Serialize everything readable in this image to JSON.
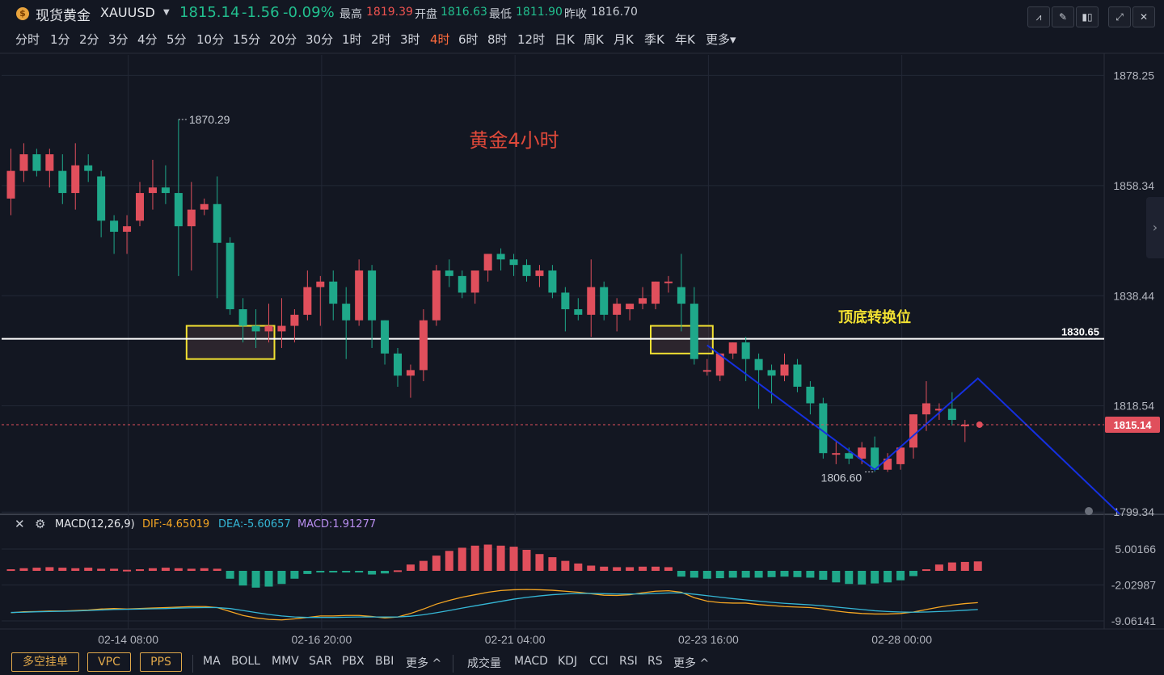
{
  "header": {
    "symbol_name": "现货黄金",
    "symbol_code": "XAUUSD",
    "price": "1815.14",
    "change": "-1.56",
    "change_pct": "-0.09%",
    "high_label": "最高",
    "high": "1819.39",
    "open_label": "开盘",
    "open": "1816.63",
    "low_label": "最低",
    "low": "1811.90",
    "prev_close_label": "昨收",
    "prev_close": "1816.70"
  },
  "intervals": [
    "分时",
    "1分",
    "2分",
    "3分",
    "4分",
    "5分",
    "10分",
    "15分",
    "20分",
    "30分",
    "1时",
    "2时",
    "3时",
    "4时",
    "6时",
    "8时",
    "12时",
    "日K",
    "周K",
    "月K",
    "季K",
    "年K",
    "更多▾"
  ],
  "active_interval": "4时",
  "bottom_buttons": [
    "多空挂单",
    "VPC",
    "PPS"
  ],
  "main_indicators": [
    "MA",
    "BOLL",
    "MMV",
    "SAR",
    "PBX",
    "BBI",
    "更多 ^"
  ],
  "sub_indicators": [
    "成交量",
    "MACD",
    "KDJ",
    "CCI",
    "RSI",
    "RS",
    "更多 ^"
  ],
  "chart_data": {
    "type": "candlestick",
    "title": "黄金4小时",
    "annotation": "顶底转换位",
    "price_axis_ticks": [
      "1878.25",
      "1858.34",
      "1838.44",
      "1818.54",
      "1799.34"
    ],
    "time_axis_ticks": [
      "02-14 08:00",
      "02-16 20:00",
      "02-21 04:00",
      "02-23 16:00",
      "02-28 00:00"
    ],
    "ylim": [
      1798.5,
      1880.5
    ],
    "horizontal_line": {
      "value": 1830.65,
      "label": "1830.65"
    },
    "current_price": {
      "value": 1815.14,
      "label": "1815.14"
    },
    "max_marker": {
      "value": 1870.29,
      "label": "1870.29"
    },
    "min_marker": {
      "value": 1806.6,
      "label": "1806.60"
    },
    "candles": [
      {
        "o": 1856.0,
        "h": 1865.0,
        "l": 1853.0,
        "c": 1861.0
      },
      {
        "o": 1861.0,
        "h": 1866.0,
        "l": 1859.0,
        "c": 1864.0
      },
      {
        "o": 1864.0,
        "h": 1865.0,
        "l": 1860.0,
        "c": 1861.0
      },
      {
        "o": 1861.0,
        "h": 1865.0,
        "l": 1858.0,
        "c": 1864.0
      },
      {
        "o": 1861.0,
        "h": 1864.0,
        "l": 1855.0,
        "c": 1857.0
      },
      {
        "o": 1857.0,
        "h": 1866.0,
        "l": 1854.0,
        "c": 1862.0
      },
      {
        "o": 1862.0,
        "h": 1864.0,
        "l": 1859.0,
        "c": 1861.0
      },
      {
        "o": 1860.0,
        "h": 1861.0,
        "l": 1849.0,
        "c": 1852.0
      },
      {
        "o": 1852.0,
        "h": 1853.0,
        "l": 1846.0,
        "c": 1850.0
      },
      {
        "o": 1850.0,
        "h": 1853.0,
        "l": 1846.0,
        "c": 1851.0
      },
      {
        "o": 1852.0,
        "h": 1859.0,
        "l": 1851.0,
        "c": 1857.0
      },
      {
        "o": 1857.0,
        "h": 1863.0,
        "l": 1854.0,
        "c": 1858.0
      },
      {
        "o": 1858.0,
        "h": 1862.0,
        "l": 1855.0,
        "c": 1857.0
      },
      {
        "o": 1857.0,
        "h": 1870.3,
        "l": 1842.0,
        "c": 1851.0
      },
      {
        "o": 1851.0,
        "h": 1859.0,
        "l": 1843.0,
        "c": 1854.0
      },
      {
        "o": 1854.0,
        "h": 1856.0,
        "l": 1853.0,
        "c": 1855.0
      },
      {
        "o": 1855.0,
        "h": 1860.0,
        "l": 1838.0,
        "c": 1848.0
      },
      {
        "o": 1848.0,
        "h": 1849.0,
        "l": 1835.0,
        "c": 1836.0
      },
      {
        "o": 1836.0,
        "h": 1838.0,
        "l": 1830.0,
        "c": 1833.0
      },
      {
        "o": 1833.0,
        "h": 1836.0,
        "l": 1829.0,
        "c": 1832.0
      },
      {
        "o": 1832.0,
        "h": 1837.0,
        "l": 1830.0,
        "c": 1833.0
      },
      {
        "o": 1832.0,
        "h": 1838.0,
        "l": 1829.0,
        "c": 1833.0
      },
      {
        "o": 1833.0,
        "h": 1836.0,
        "l": 1830.0,
        "c": 1835.0
      },
      {
        "o": 1835.0,
        "h": 1843.0,
        "l": 1834.0,
        "c": 1840.0
      },
      {
        "o": 1840.0,
        "h": 1842.0,
        "l": 1833.0,
        "c": 1841.0
      },
      {
        "o": 1841.0,
        "h": 1843.0,
        "l": 1834.0,
        "c": 1837.0
      },
      {
        "o": 1837.0,
        "h": 1840.0,
        "l": 1827.0,
        "c": 1834.0
      },
      {
        "o": 1834.0,
        "h": 1845.0,
        "l": 1833.0,
        "c": 1843.0
      },
      {
        "o": 1843.0,
        "h": 1844.0,
        "l": 1829.0,
        "c": 1834.0
      },
      {
        "o": 1834.0,
        "h": 1834.0,
        "l": 1826.0,
        "c": 1828.0
      },
      {
        "o": 1828.0,
        "h": 1829.0,
        "l": 1822.0,
        "c": 1824.0
      },
      {
        "o": 1824.0,
        "h": 1826.0,
        "l": 1820.0,
        "c": 1825.0
      },
      {
        "o": 1825.0,
        "h": 1836.0,
        "l": 1823.0,
        "c": 1834.0
      },
      {
        "o": 1834.0,
        "h": 1844.0,
        "l": 1833.0,
        "c": 1843.0
      },
      {
        "o": 1843.0,
        "h": 1845.0,
        "l": 1840.0,
        "c": 1842.0
      },
      {
        "o": 1842.0,
        "h": 1843.0,
        "l": 1838.0,
        "c": 1839.0
      },
      {
        "o": 1839.0,
        "h": 1843.0,
        "l": 1837.0,
        "c": 1843.0
      },
      {
        "o": 1843.0,
        "h": 1846.0,
        "l": 1841.0,
        "c": 1846.0
      },
      {
        "o": 1846.0,
        "h": 1847.0,
        "l": 1843.0,
        "c": 1845.0
      },
      {
        "o": 1845.0,
        "h": 1846.0,
        "l": 1842.0,
        "c": 1844.0
      },
      {
        "o": 1844.0,
        "h": 1845.0,
        "l": 1841.0,
        "c": 1842.0
      },
      {
        "o": 1842.0,
        "h": 1844.0,
        "l": 1840.0,
        "c": 1843.0
      },
      {
        "o": 1843.0,
        "h": 1844.0,
        "l": 1838.0,
        "c": 1839.0
      },
      {
        "o": 1839.0,
        "h": 1840.0,
        "l": 1832.0,
        "c": 1836.0
      },
      {
        "o": 1836.0,
        "h": 1838.0,
        "l": 1834.0,
        "c": 1835.0
      },
      {
        "o": 1835.0,
        "h": 1845.0,
        "l": 1831.0,
        "c": 1840.0
      },
      {
        "o": 1840.0,
        "h": 1841.0,
        "l": 1834.0,
        "c": 1835.0
      },
      {
        "o": 1835.0,
        "h": 1838.0,
        "l": 1832.0,
        "c": 1837.0
      },
      {
        "o": 1836.0,
        "h": 1837.0,
        "l": 1834.0,
        "c": 1837.0
      },
      {
        "o": 1837.0,
        "h": 1840.0,
        "l": 1836.0,
        "c": 1838.0
      },
      {
        "o": 1837.0,
        "h": 1841.0,
        "l": 1836.0,
        "c": 1841.0
      },
      {
        "o": 1841.0,
        "h": 1842.0,
        "l": 1839.0,
        "c": 1841.0
      },
      {
        "o": 1840.0,
        "h": 1846.0,
        "l": 1832.0,
        "c": 1837.0
      },
      {
        "o": 1837.0,
        "h": 1840.0,
        "l": 1826.0,
        "c": 1827.0
      },
      {
        "o": 1825.0,
        "h": 1827.0,
        "l": 1824.0,
        "c": 1825.0
      },
      {
        "o": 1824.0,
        "h": 1828.0,
        "l": 1823.0,
        "c": 1828.0
      },
      {
        "o": 1828.0,
        "h": 1830.0,
        "l": 1827.0,
        "c": 1830.0
      },
      {
        "o": 1830.0,
        "h": 1831.0,
        "l": 1823.0,
        "c": 1827.0
      },
      {
        "o": 1827.0,
        "h": 1828.0,
        "l": 1818.0,
        "c": 1825.0
      },
      {
        "o": 1825.0,
        "h": 1826.0,
        "l": 1819.0,
        "c": 1824.0
      },
      {
        "o": 1824.0,
        "h": 1828.0,
        "l": 1823.0,
        "c": 1826.0
      },
      {
        "o": 1826.0,
        "h": 1827.0,
        "l": 1821.0,
        "c": 1822.0
      },
      {
        "o": 1822.0,
        "h": 1823.0,
        "l": 1817.0,
        "c": 1819.0
      },
      {
        "o": 1819.0,
        "h": 1820.0,
        "l": 1809.0,
        "c": 1810.0
      },
      {
        "o": 1810.0,
        "h": 1812.0,
        "l": 1808.0,
        "c": 1810.0
      },
      {
        "o": 1810.0,
        "h": 1811.0,
        "l": 1808.0,
        "c": 1809.0
      },
      {
        "o": 1809.0,
        "h": 1812.0,
        "l": 1808.0,
        "c": 1811.0
      },
      {
        "o": 1811.0,
        "h": 1813.0,
        "l": 1806.6,
        "c": 1807.0
      },
      {
        "o": 1807.0,
        "h": 1810.0,
        "l": 1806.6,
        "c": 1809.0
      },
      {
        "o": 1808.0,
        "h": 1811.0,
        "l": 1807.0,
        "c": 1811.0
      },
      {
        "o": 1811.0,
        "h": 1817.0,
        "l": 1809.0,
        "c": 1817.0
      },
      {
        "o": 1817.0,
        "h": 1823.0,
        "l": 1814.0,
        "c": 1819.0
      },
      {
        "o": 1818.0,
        "h": 1819.0,
        "l": 1816.0,
        "c": 1818.0
      },
      {
        "o": 1818.0,
        "h": 1821.0,
        "l": 1815.0,
        "c": 1816.0
      },
      {
        "o": 1815.0,
        "h": 1816.0,
        "l": 1812.0,
        "c": 1815.14
      }
    ],
    "zones": [
      {
        "from_index": 14,
        "to_index": 20,
        "low": 1827.0,
        "high": 1833.0
      },
      {
        "from_index": 50,
        "to_index": 54,
        "low": 1828.0,
        "high": 1833.0
      }
    ],
    "path_line": [
      {
        "index": 54,
        "value": 1829.5
      },
      {
        "index": 67,
        "value": 1807.0
      },
      {
        "index": 75,
        "value": 1823.5
      },
      {
        "index": 86,
        "value": 1799.0
      }
    ],
    "macd": {
      "label": "MACD(12,26,9)",
      "dif_label": "DIF:-4.65019",
      "dea_label": "DEA:-5.60657",
      "macd_label": "MACD:1.91277",
      "axis_ticks": [
        "5.00166",
        "-2.02987",
        "-9.06141"
      ],
      "ylim": [
        -10.5,
        9
      ],
      "histogram": [
        0.3,
        0.5,
        0.6,
        0.7,
        0.6,
        0.5,
        0.6,
        0.4,
        0.4,
        0.2,
        0.3,
        0.5,
        0.6,
        0.5,
        0.4,
        0.5,
        0.4,
        -1.5,
        -2.8,
        -3.2,
        -3.0,
        -2.5,
        -1.5,
        -0.6,
        -0.3,
        -0.2,
        -0.3,
        -0.3,
        -0.7,
        -0.5,
        0.1,
        1.2,
        1.9,
        2.9,
        3.8,
        4.4,
        4.8,
        5.0,
        4.8,
        4.6,
        4.0,
        3.2,
        2.6,
        1.9,
        1.4,
        1.0,
        0.8,
        0.7,
        0.7,
        0.8,
        0.8,
        0.7,
        -1.1,
        -1.3,
        -1.5,
        -1.4,
        -1.3,
        -1.3,
        -1.3,
        -1.2,
        -1.1,
        -1.2,
        -1.3,
        -1.7,
        -2.2,
        -2.5,
        -2.6,
        -2.4,
        -2.2,
        -1.8,
        -1.0,
        0.3,
        1.2,
        1.6,
        1.7,
        1.8
      ],
      "dif": [
        -6.5,
        -6.1,
        -6.0,
        -5.8,
        -5.8,
        -5.6,
        -5.4,
        -5.0,
        -4.8,
        -5.0,
        -4.8,
        -4.6,
        -4.4,
        -4.2,
        -4.0,
        -4.0,
        -4.4,
        -6.0,
        -7.6,
        -8.6,
        -9.2,
        -9.4,
        -9.0,
        -8.4,
        -7.8,
        -7.8,
        -7.6,
        -7.6,
        -8.0,
        -8.6,
        -8.2,
        -6.8,
        -5.0,
        -3.0,
        -1.5,
        -0.2,
        0.8,
        1.8,
        2.5,
        2.8,
        2.9,
        2.8,
        2.6,
        2.2,
        1.8,
        1.2,
        0.6,
        0.5,
        0.8,
        1.6,
        2.2,
        2.4,
        1.8,
        -0.4,
        -1.8,
        -2.4,
        -2.6,
        -2.6,
        -3.2,
        -3.6,
        -4.0,
        -4.2,
        -4.4,
        -5.0,
        -5.8,
        -6.4,
        -6.8,
        -7.0,
        -7.0,
        -6.8,
        -6.2,
        -5.2,
        -4.2,
        -3.4,
        -2.8,
        -2.4
      ],
      "dea": [
        -6.4,
        -6.3,
        -6.1,
        -6.0,
        -5.9,
        -5.8,
        -5.6,
        -5.4,
        -5.2,
        -5.1,
        -5.0,
        -4.9,
        -4.8,
        -4.6,
        -4.5,
        -4.4,
        -4.4,
        -4.8,
        -5.6,
        -6.4,
        -7.2,
        -7.8,
        -8.2,
        -8.4,
        -8.4,
        -8.4,
        -8.3,
        -8.2,
        -8.2,
        -8.2,
        -8.2,
        -7.9,
        -7.3,
        -6.5,
        -5.6,
        -4.6,
        -3.7,
        -2.8,
        -1.9,
        -1.0,
        -0.3,
        0.3,
        0.8,
        1.1,
        1.3,
        1.3,
        1.2,
        1.1,
        1.1,
        1.1,
        1.3,
        1.5,
        1.5,
        1.0,
        0.4,
        -0.2,
        -0.8,
        -1.3,
        -1.8,
        -2.3,
        -2.7,
        -3.0,
        -3.3,
        -3.7,
        -4.2,
        -4.7,
        -5.2,
        -5.7,
        -6.0,
        -6.2,
        -6.3,
        -6.2,
        -6.0,
        -5.8,
        -5.5,
        -5.2
      ]
    }
  }
}
